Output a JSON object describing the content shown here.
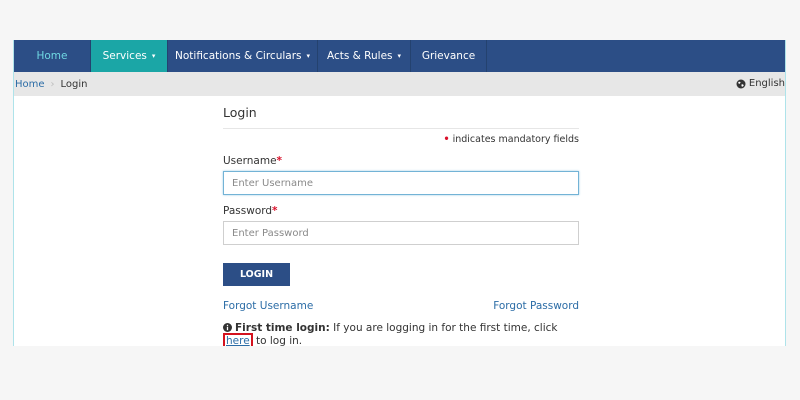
{
  "nav": {
    "home": "Home",
    "services": "Services",
    "notifications": "Notifications & Circulars",
    "acts": "Acts & Rules",
    "grievance": "Grievance",
    "dropdown_glyph": "▾"
  },
  "breadcrumb": {
    "home": "Home",
    "separator": "›",
    "current": "Login"
  },
  "language": "English",
  "login": {
    "title": "Login",
    "mandatory_mark": "•",
    "mandatory_note": "indicates mandatory fields",
    "username_label": "Username",
    "username_placeholder": "Enter Username",
    "password_label": "Password",
    "password_placeholder": "Enter Password",
    "required_mark": "*",
    "button": "LOGIN",
    "forgot_username": "Forgot Username",
    "forgot_password": "Forgot Password",
    "first_time_title": "First time login:",
    "first_time_text": "If you are logging in for the first time, click",
    "here": "here",
    "first_time_end": "to log in."
  },
  "colors": {
    "navbar": "#2c4e86",
    "active_tab": "#1ba6a6",
    "link": "#2b6ca6",
    "required": "#d9112b",
    "highlight_box": "#d4121e"
  }
}
